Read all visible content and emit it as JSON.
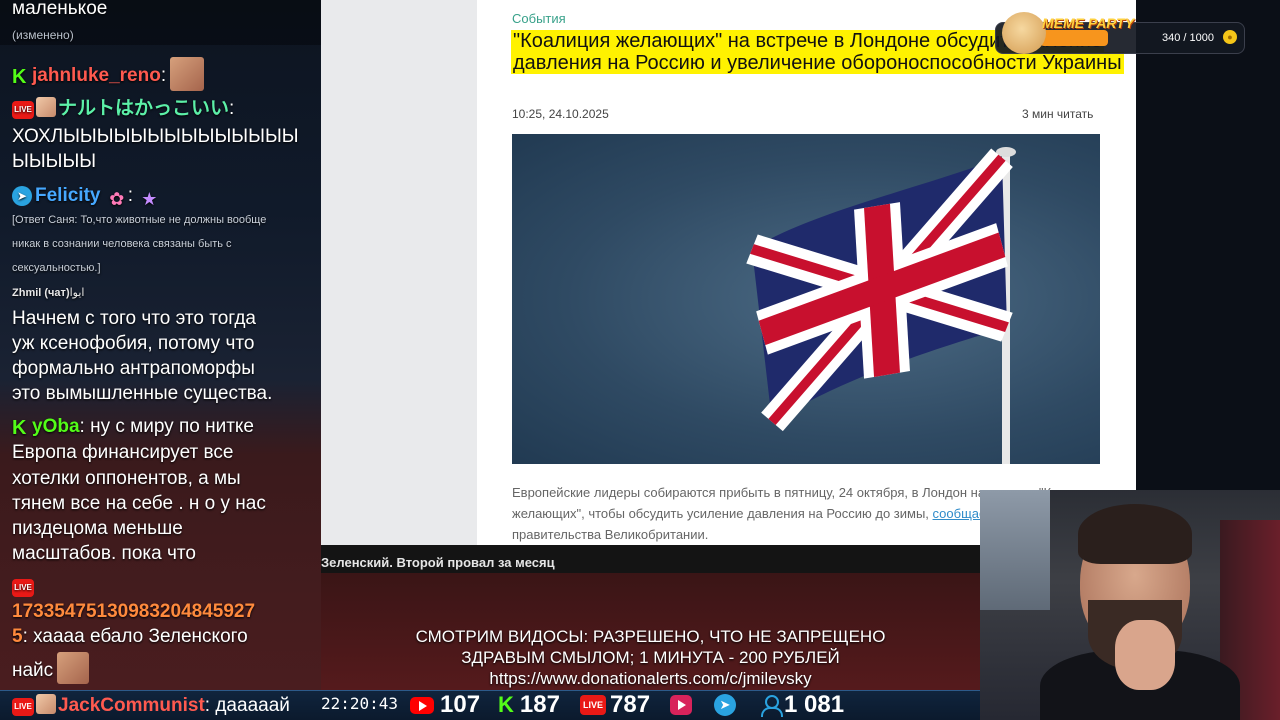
{
  "chat": {
    "messages": [
      {
        "text": "маленькое"
      },
      {
        "text": "(изменено)"
      },
      {
        "user": "jahnluke_reno",
        "sep": ":"
      },
      {
        "user": "ナルトはかっこいい",
        "sep": ":"
      },
      {
        "text": "ХОХЛЫЫЫЫЫЫЫЫЫЫЫЫЫЫ"
      },
      {
        "text": "ЫЫЫЫЫ"
      },
      {
        "user": "Felicity",
        "sep": ":"
      },
      {
        "text": "[Ответ Саня: То,что животные не должны вообще"
      },
      {
        "text": "никак в сознании человека связаны быть с"
      },
      {
        "text": "сексуальностью.]"
      },
      {
        "user": "Zhmil (чат)",
        "suffix": "ايوا"
      },
      {
        "text": "Начнем с того что это тогда"
      },
      {
        "text": "уж ксенофобия, потому что"
      },
      {
        "text": "формально антрапоморфы"
      },
      {
        "text": "это вымышленные существа."
      },
      {
        "user": "yOba",
        "sep": ":",
        "text": "ну с миру по нитке"
      },
      {
        "text": "Европа финансирует все"
      },
      {
        "text": "хотелки оппонентов, а мы"
      },
      {
        "text": "тянем все на себе . н о у нас"
      },
      {
        "text": "пиздецома меньше"
      },
      {
        "text": "масштабов. пока что"
      },
      {
        "user": "17335475130983204845927",
        "user_cont": "5",
        "sep": ":",
        "text": "хаааа ебало Зеленского"
      },
      {
        "text": "найс"
      }
    ],
    "bottom_message": {
      "user": "JackCommunist",
      "sep": ":",
      "text": "дааааай"
    }
  },
  "article": {
    "category": "События",
    "headline": "\"Коалиция желающих\" на встрече в Лондоне обсудит усиление давления на Россию и увеличение обороноспособности Украины",
    "date": "10:25, 24.10.2025",
    "read_time": "3 мин читать",
    "paragraph_before_link": "Европейские лидеры собираются прибыть в пятницу, 24 октября, в Лондон на встречу \"Коалиции желающих\", чтобы обсудить усиление давления на Россию до зимы, ",
    "link_text": "сообщает пресс-служба",
    "paragraph_after_link": " правительства Великобритании."
  },
  "video_title": "Зеленский. Второй провал за месяц",
  "donation": {
    "line1": "СМОТРИМ ВИДОСЫ: РАЗРЕШЕНО, ЧТО НЕ ЗАПРЕЩЕНО",
    "line2": "ЗДРАВЫМ СМЫЛОМ; 1 МИНУТА - 200 РУБЛЕЙ",
    "url": "https://www.donationalerts.com/c/jmilevsky"
  },
  "meme_party": {
    "title": "MEME PARTY",
    "progress": "340 / 1000",
    "fraction": 0.34
  },
  "status": {
    "clock": "22:20:43",
    "youtube": "107",
    "kick": "187",
    "vklive": "787",
    "total_viewers": "1 081"
  },
  "colors": {
    "kick": "#53fc18",
    "youtube": "#ff0000",
    "telegram": "#2aa3e0",
    "highlight": "#fff200"
  }
}
